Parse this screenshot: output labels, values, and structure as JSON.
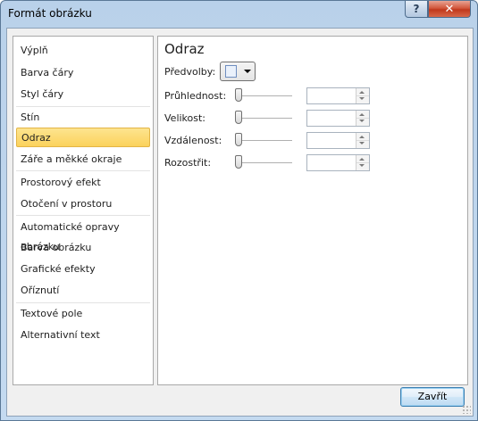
{
  "window": {
    "title": "Formát obrázku",
    "help_label": "?",
    "close_label": "✕"
  },
  "nav": {
    "items": [
      {
        "label": "Výplň",
        "selected": false
      },
      {
        "label": "Barva čáry",
        "selected": false
      },
      {
        "label": "Styl čáry",
        "selected": false
      },
      {
        "label": "Stín",
        "selected": false
      },
      {
        "label": "Odraz",
        "selected": true
      },
      {
        "label": "Záře a měkké okraje",
        "selected": false
      },
      {
        "label": "Prostorový efekt",
        "selected": false
      },
      {
        "label": "Otočení v prostoru",
        "selected": false
      },
      {
        "label": "Automatické opravy obrázku",
        "selected": false
      },
      {
        "label": "Barva obrázku",
        "selected": false
      },
      {
        "label": "Grafické efekty",
        "selected": false
      },
      {
        "label": "Oříznutí",
        "selected": false
      },
      {
        "label": "Textové pole",
        "selected": false
      },
      {
        "label": "Alternativní text",
        "selected": false
      }
    ]
  },
  "panel": {
    "title": "Odraz",
    "presets_label": "Předvolby:",
    "rows": [
      {
        "label": "Průhlednost:",
        "value": "",
        "slider_level": 0
      },
      {
        "label": "Velikost:",
        "value": "",
        "slider_level": 0
      },
      {
        "label": "Vzdálenost:",
        "value": "",
        "slider_level": 0
      },
      {
        "label": "Rozostřit:",
        "value": "",
        "slider_level": 0
      }
    ]
  },
  "footer": {
    "close_button_label": "Zavřít"
  },
  "colors": {
    "selected_item": "#fbd25c",
    "window_frame": "#b9d1ea",
    "close_caption": "#c0381c"
  }
}
